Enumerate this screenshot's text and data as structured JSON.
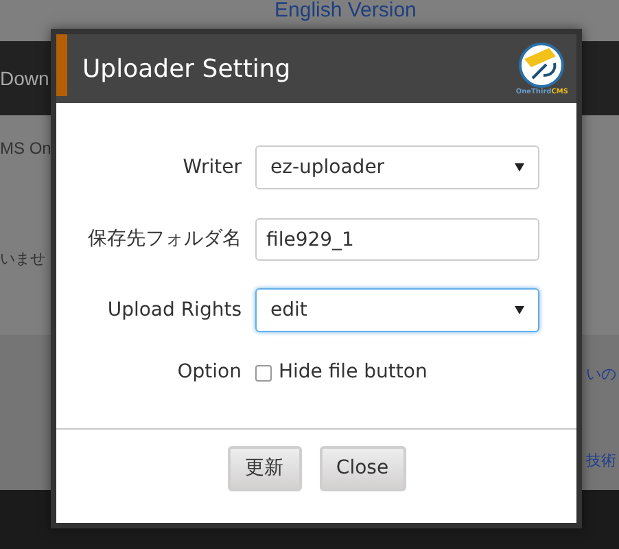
{
  "background": {
    "top_link": "English Version",
    "nav_text": "Down",
    "line_1": "MS On",
    "line_2": "いませ",
    "link_1": "いの",
    "link_2": "技術"
  },
  "dialog": {
    "title": "Uploader Setting",
    "logo": {
      "caption_main": "OneThird",
      "caption_accent": "CMS"
    },
    "fields": [
      {
        "kind": "select",
        "label": "Writer",
        "value": "ez-uploader",
        "focused": false
      },
      {
        "kind": "text",
        "label": "保存先フォルダ名",
        "value": "file929_1",
        "focused": false
      },
      {
        "kind": "select",
        "label": "Upload Rights",
        "value": "edit",
        "focused": true
      },
      {
        "kind": "checkbox",
        "label": "Option",
        "option": "Hide file button",
        "checked": false
      }
    ],
    "buttons": [
      "更新",
      "Close"
    ]
  }
}
